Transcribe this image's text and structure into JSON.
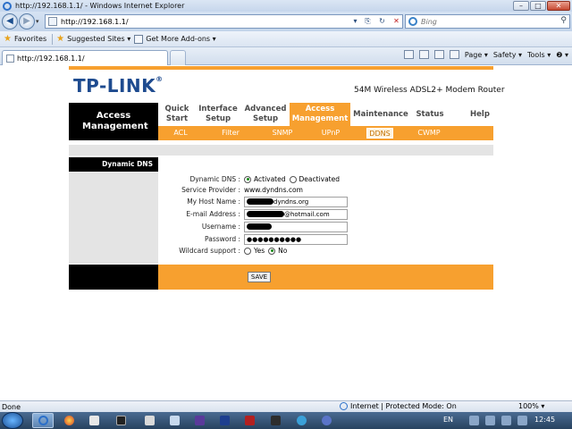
{
  "window": {
    "title": "http://192.168.1.1/ - Windows Internet Explorer"
  },
  "address_bar": {
    "url": "http://192.168.1.1/"
  },
  "search": {
    "placeholder": "Bing"
  },
  "favorites_bar": {
    "favorites_label": "Favorites",
    "suggested_label": "Suggested Sites ▾",
    "addons_label": "Get More Add-ons ▾"
  },
  "tab": {
    "label": "http://192.168.1.1/"
  },
  "command_bar": {
    "page": "Page ▾",
    "safety": "Safety ▾",
    "tools": "Tools ▾",
    "help": "❷ ▾"
  },
  "router": {
    "brand": "TP-LINK",
    "model": "54M Wireless ADSL2+ Modem Router",
    "section_title": "Access Management",
    "menu": [
      {
        "label": "Quick Start",
        "active": false
      },
      {
        "label": "Interface Setup",
        "active": false
      },
      {
        "label": "Advanced Setup",
        "active": false
      },
      {
        "label": "Access Management",
        "active": true
      },
      {
        "label": "Maintenance",
        "active": false
      },
      {
        "label": "Status",
        "active": false
      },
      {
        "label": "Help",
        "active": false
      }
    ],
    "submenu": [
      {
        "label": "ACL",
        "active": false
      },
      {
        "label": "Filter",
        "active": false
      },
      {
        "label": "SNMP",
        "active": false
      },
      {
        "label": "UPnP",
        "active": false
      },
      {
        "label": "DDNS",
        "active": true
      },
      {
        "label": "CWMP",
        "active": false
      }
    ],
    "panel_title": "Dynamic DNS",
    "form": {
      "dynamic_dns_label": "Dynamic DNS :",
      "activated": "Activated",
      "deactivated": "Deactivated",
      "provider_label": "Service Provider :",
      "provider_value": "www.dyndns.com",
      "host_label": "My Host Name :",
      "host_suffix": "dyndns.org",
      "email_label": "E-mail Address :",
      "email_suffix": "@hotmail.com",
      "username_label": "Username :",
      "password_label": "Password :",
      "password_value": "●●●●●●●●●●",
      "wildcard_label": "Wildcard support :",
      "yes": "Yes",
      "no": "No"
    },
    "save_label": "SAVE"
  },
  "status_bar": {
    "done": "Done",
    "zone": "Internet | Protected Mode: On",
    "zoom": "100%  ▾"
  },
  "taskbar": {
    "lang": "EN",
    "clock": "12:45"
  },
  "colors": {
    "accent_orange": "#f7a02f",
    "logo_blue": "#1e4b8f"
  }
}
